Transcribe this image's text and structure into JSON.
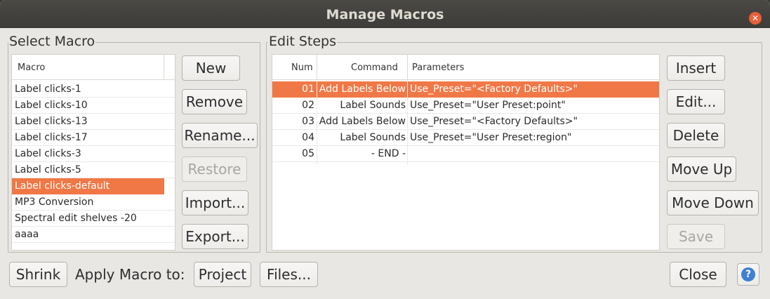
{
  "window": {
    "title": "Manage Macros"
  },
  "select_macro": {
    "group_label": "Select Macro",
    "column_header": "Macro",
    "items": [
      {
        "label": "Label clicks-1"
      },
      {
        "label": "Label clicks-10"
      },
      {
        "label": "Label clicks-13"
      },
      {
        "label": "Label clicks-17"
      },
      {
        "label": "Label clicks-3"
      },
      {
        "label": "Label clicks-5"
      },
      {
        "label": "Label clicks-default",
        "selected": true
      },
      {
        "label": "MP3 Conversion"
      },
      {
        "label": "Spectral edit shelves -20"
      },
      {
        "label": "aaaa"
      }
    ],
    "buttons": {
      "new": "New",
      "remove": "Remove",
      "rename": "Rename...",
      "restore": "Restore",
      "import": "Import...",
      "export": "Export..."
    }
  },
  "edit_steps": {
    "group_label": "Edit Steps",
    "columns": {
      "num": "Num",
      "command": "Command",
      "parameters": "Parameters"
    },
    "rows": [
      {
        "num": "01",
        "command": "Add Labels Below",
        "parameters": "Use_Preset=\"<Factory Defaults>\"",
        "selected": true
      },
      {
        "num": "02",
        "command": "Label Sounds",
        "parameters": "Use_Preset=\"User Preset:point\""
      },
      {
        "num": "03",
        "command": "Add Labels Below",
        "parameters": "Use_Preset=\"<Factory Defaults>\""
      },
      {
        "num": "04",
        "command": "Label Sounds",
        "parameters": "Use_Preset=\"User Preset:region\""
      },
      {
        "num": "05",
        "command": "- END -",
        "parameters": ""
      }
    ],
    "buttons": {
      "insert": "Insert",
      "edit": "Edit...",
      "delete": "Delete",
      "move_up": "Move Up",
      "move_down": "Move Down",
      "save": "Save"
    }
  },
  "footer": {
    "shrink": "Shrink",
    "apply_label": "Apply Macro to:",
    "project": "Project",
    "files": "Files...",
    "close": "Close",
    "help_glyph": "?"
  },
  "colors": {
    "selection": "#f07846",
    "titlebar": "#3d3c38",
    "close_button": "#e8603a",
    "help": "#3f7fd6"
  }
}
